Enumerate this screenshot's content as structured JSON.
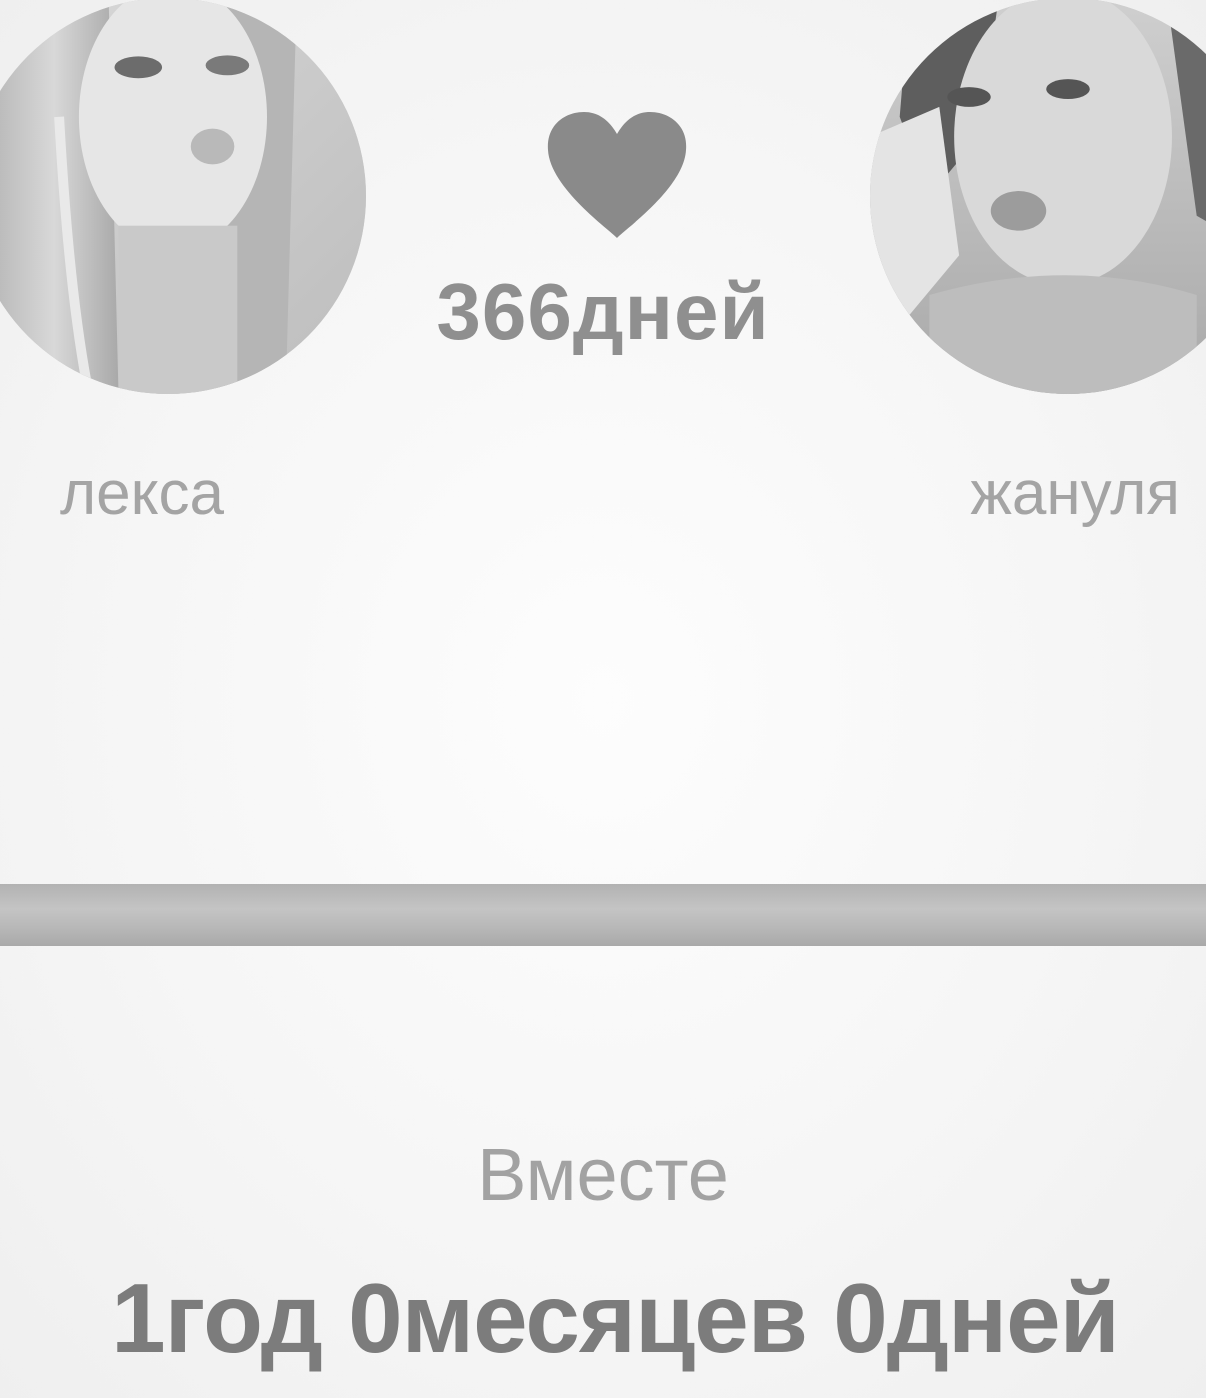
{
  "couple": {
    "left": {
      "name": "лекса"
    },
    "right": {
      "name": "жануля"
    }
  },
  "counter": {
    "days": "366дней",
    "heart_icon": "heart-icon"
  },
  "progress": {
    "fraction": 1.0
  },
  "together": {
    "label": "Вместе",
    "duration": "1год 0месяцев 0дней"
  },
  "colors": {
    "heart": "#8a8a8a",
    "days_text": "#8f8f8f",
    "name_text": "#a4a4a4",
    "duration_text": "#7c7c7c"
  }
}
